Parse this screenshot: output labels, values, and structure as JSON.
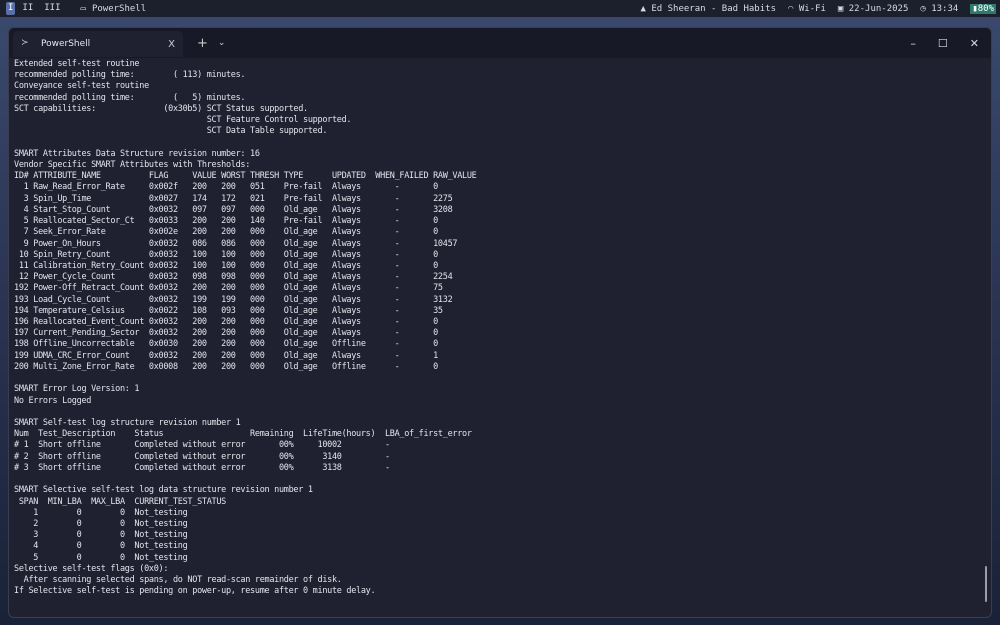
{
  "topbar": {
    "workspaces": [
      "I",
      "II",
      "III"
    ],
    "active_app": "PowerShell",
    "music": "Ed Sheeran - Bad Habits",
    "wifi": "Wi-Fi",
    "date": "22-Jun-2025",
    "time": "13:34",
    "battery": "80%"
  },
  "window": {
    "tab_title": "PowerShell",
    "tab_close": "X",
    "new_tab": "+",
    "dropdown": "⌄",
    "minimize": "–",
    "maximize": "☐",
    "close": "✕"
  },
  "terminal": {
    "lines": [
      "Extended self-test routine",
      "recommended polling time:        ( 113) minutes.",
      "Conveyance self-test routine",
      "recommended polling time:        (   5) minutes.",
      "SCT capabilities:              (0x30b5) SCT Status supported.",
      "                                        SCT Feature Control supported.",
      "                                        SCT Data Table supported.",
      "",
      "SMART Attributes Data Structure revision number: 16",
      "Vendor Specific SMART Attributes with Thresholds:",
      "ID# ATTRIBUTE_NAME          FLAG     VALUE WORST THRESH TYPE      UPDATED  WHEN_FAILED RAW_VALUE",
      "  1 Raw_Read_Error_Rate     0x002f   200   200   051    Pre-fail  Always       -       0",
      "  3 Spin_Up_Time            0x0027   174   172   021    Pre-fail  Always       -       2275",
      "  4 Start_Stop_Count        0x0032   097   097   000    Old_age   Always       -       3208",
      "  5 Reallocated_Sector_Ct   0x0033   200   200   140    Pre-fail  Always       -       0",
      "  7 Seek_Error_Rate         0x002e   200   200   000    Old_age   Always       -       0",
      "  9 Power_On_Hours          0x0032   086   086   000    Old_age   Always       -       10457",
      " 10 Spin_Retry_Count        0x0032   100   100   000    Old_age   Always       -       0",
      " 11 Calibration_Retry_Count 0x0032   100   100   000    Old_age   Always       -       0",
      " 12 Power_Cycle_Count       0x0032   098   098   000    Old_age   Always       -       2254",
      "192 Power-Off_Retract_Count 0x0032   200   200   000    Old_age   Always       -       75",
      "193 Load_Cycle_Count        0x0032   199   199   000    Old_age   Always       -       3132",
      "194 Temperature_Celsius     0x0022   108   093   000    Old_age   Always       -       35",
      "196 Reallocated_Event_Count 0x0032   200   200   000    Old_age   Always       -       0",
      "197 Current_Pending_Sector  0x0032   200   200   000    Old_age   Always       -       0",
      "198 Offline_Uncorrectable   0x0030   200   200   000    Old_age   Offline      -       0",
      "199 UDMA_CRC_Error_Count    0x0032   200   200   000    Old_age   Always       -       1",
      "200 Multi_Zone_Error_Rate   0x0008   200   200   000    Old_age   Offline      -       0",
      "",
      "SMART Error Log Version: 1",
      "No Errors Logged",
      "",
      "SMART Self-test log structure revision number 1",
      "Num  Test_Description    Status                  Remaining  LifeTime(hours)  LBA_of_first_error",
      "# 1  Short offline       Completed without error       00%     10002         -",
      "# 2  Short offline       Completed without error       00%      3140         -",
      "# 3  Short offline       Completed without error       00%      3138         -",
      "",
      "SMART Selective self-test log data structure revision number 1",
      " SPAN  MIN_LBA  MAX_LBA  CURRENT_TEST_STATUS",
      "    1        0        0  Not_testing",
      "    2        0        0  Not_testing",
      "    3        0        0  Not_testing",
      "    4        0        0  Not_testing",
      "    5        0        0  Not_testing",
      "Selective self-test flags (0x0):",
      "  After scanning selected spans, do NOT read-scan remainder of disk.",
      "If Selective self-test is pending on power-up, resume after 0 minute delay."
    ]
  }
}
